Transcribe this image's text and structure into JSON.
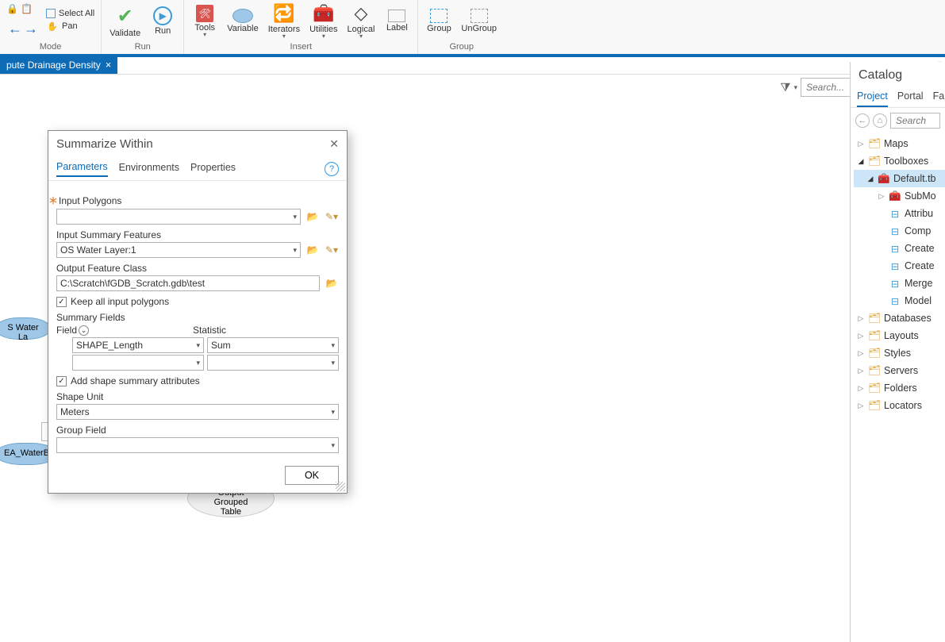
{
  "ribbon": {
    "mode": {
      "select_all": "Select All",
      "pan": "Pan",
      "group_label": "Mode"
    },
    "run": {
      "validate": "Validate",
      "run": "Run",
      "group_label": "Run"
    },
    "insert": {
      "tools": "Tools",
      "variable": "Variable",
      "iterators": "Iterators",
      "utilities": "Utilities",
      "logical": "Logical",
      "label": "Label",
      "group_label": "Insert"
    },
    "group": {
      "group": "Group",
      "ungroup": "UnGroup",
      "group_label": "Group"
    }
  },
  "tab": {
    "title": "pute Drainage Density"
  },
  "canvas": {
    "search_placeholder": "Search...",
    "bubble1": "S Water La",
    "bubble2": "EA_WaterB",
    "ellipse": "Output Grouped\nTable"
  },
  "dialog": {
    "title": "Summarize Within",
    "tabs": {
      "parameters": "Parameters",
      "environments": "Environments",
      "properties": "Properties"
    },
    "labels": {
      "input_polygons": "Input Polygons",
      "input_summary_features": "Input Summary Features",
      "output_feature_class": "Output Feature Class",
      "keep_all": "Keep all input polygons",
      "summary_fields": "Summary Fields",
      "field": "Field",
      "statistic": "Statistic",
      "add_shape": "Add shape summary attributes",
      "shape_unit": "Shape Unit",
      "group_field": "Group Field"
    },
    "values": {
      "input_polygons": "",
      "input_summary_features": "OS Water Layer:1",
      "output_feature_class": "C:\\Scratch\\fGDB_Scratch.gdb\\test",
      "keep_all_checked": true,
      "summary_field_0_field": "SHAPE_Length",
      "summary_field_0_stat": "Sum",
      "add_shape_checked": true,
      "shape_unit": "Meters",
      "group_field": ""
    },
    "ok": "OK"
  },
  "catalog": {
    "title": "Catalog",
    "tabs": {
      "project": "Project",
      "portal": "Portal",
      "fav": "Fa"
    },
    "search_placeholder": "Search",
    "tree": {
      "maps": "Maps",
      "toolboxes": "Toolboxes",
      "default_tbx": "Default.tb",
      "submo": "SubMo",
      "attrib": "Attribu",
      "comp": "Comp",
      "create1": "Create",
      "create2": "Create",
      "merge": "Merge",
      "model": "Model",
      "databases": "Databases",
      "layouts": "Layouts",
      "styles": "Styles",
      "servers": "Servers",
      "folders": "Folders",
      "locators": "Locators"
    }
  }
}
